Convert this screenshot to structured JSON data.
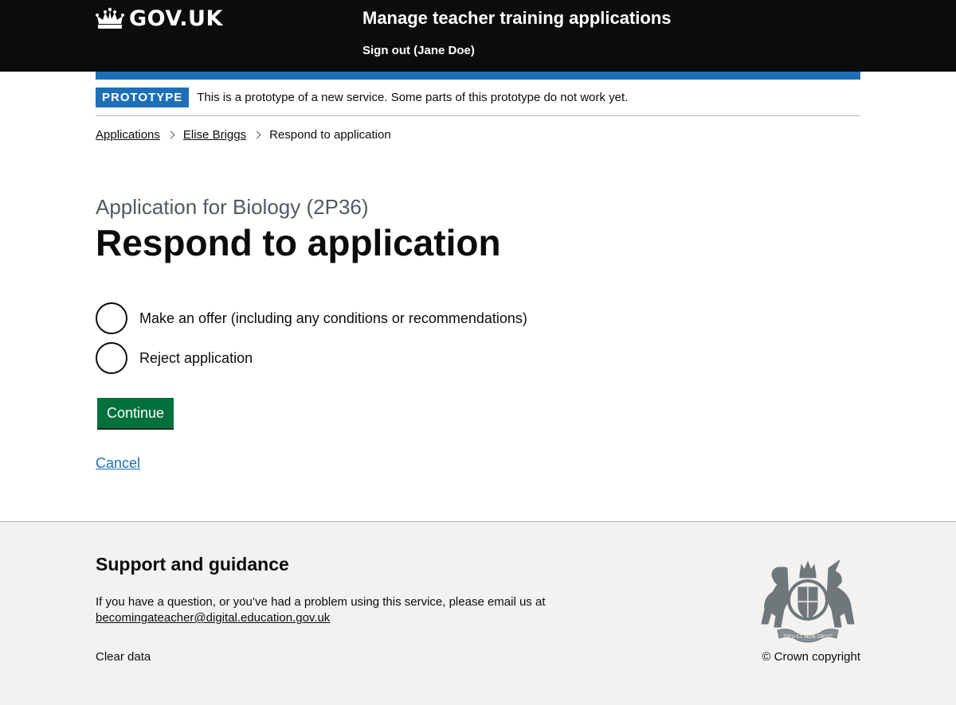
{
  "header": {
    "logo_text": "GOV.UK",
    "service_name": "Manage teacher training applications",
    "signout_label": "Sign out (Jane Doe)"
  },
  "phase_banner": {
    "tag": "PROTOTYPE",
    "text": "This is a prototype of a new service. Some parts of this prototype do not work yet."
  },
  "breadcrumbs": [
    "Applications",
    "Elise Briggs",
    "Respond to application"
  ],
  "main": {
    "caption": "Application for Biology (2P36)",
    "title": "Respond to application",
    "options": [
      {
        "label": "Make an offer (including any conditions or recommendations)",
        "selected": false
      },
      {
        "label": "Reject application",
        "selected": false
      }
    ],
    "continue_label": "Continue",
    "cancel_label": "Cancel"
  },
  "footer": {
    "title": "Support and guidance",
    "text": "If you have a question, or you’ve had a problem using this service, please email us at",
    "email": "becomingateacher@digital.education.gov.uk",
    "clear_data_label": "Clear data",
    "copyright": "© Crown copyright",
    "crest_motto_top": "DIEU ET MON DROIT"
  },
  "colors": {
    "header_bg": "#0b0c0c",
    "brand_blue": "#1d70b8",
    "button_green": "#00703c",
    "footer_bg": "#f3f2f1",
    "secondary_text": "#505a5f"
  }
}
